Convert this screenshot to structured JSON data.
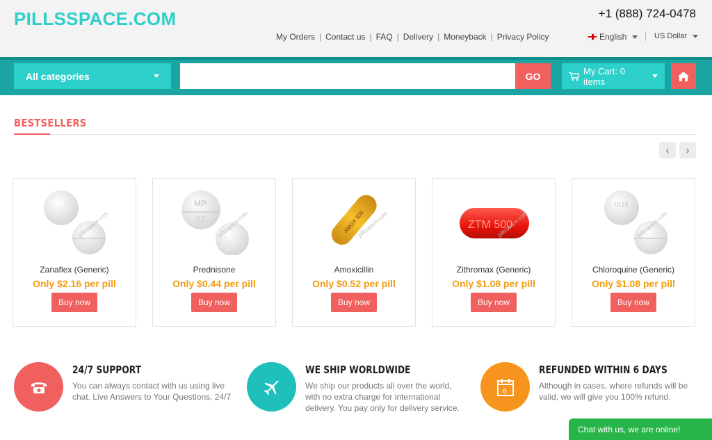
{
  "header": {
    "logo": "PILLSSPACE.COM",
    "phone": "+1 (888) 724-0478",
    "nav": [
      "My Orders",
      "Contact us",
      "FAQ",
      "Delivery",
      "Moneyback",
      "Privacy Policy"
    ],
    "language": "English",
    "currency": "US Dollar"
  },
  "toolbar": {
    "category": "All categories",
    "search_value": "",
    "go_label": "GO",
    "cart_label": "My Cart: 0 items"
  },
  "bestsellers": {
    "title": "BESTSELLERS",
    "watermark": "pillsspace.com",
    "products": [
      {
        "name": "Zanaflex (Generic)",
        "price": "Only $2.16 per pill",
        "button": "Buy now"
      },
      {
        "name": "Prednisone",
        "price": "Only $0.44 per pill",
        "button": "Buy now"
      },
      {
        "name": "Amoxicillin",
        "price": "Only $0.52 per pill",
        "button": "Buy now"
      },
      {
        "name": "Zithromax (Generic)",
        "price": "Only $1.08 per pill",
        "button": "Buy now"
      },
      {
        "name": "Chloroquine (Generic)",
        "price": "Only $1.08 per pill",
        "button": "Buy now"
      }
    ],
    "pill_text": {
      "prednisone": "MP",
      "prednisone2": "52",
      "amoxicillin": "AMOX 500",
      "zithromax": "ZTM 500",
      "chloroquine": "0115"
    }
  },
  "features": [
    {
      "title": "24/7 SUPPORT",
      "text": "You can always contact with us using live chat. Live Answers to Your Questions, 24/7",
      "color": "#f0605e",
      "icon": "phone-icon"
    },
    {
      "title": "WE SHIP WORLDWIDE",
      "text": "We ship our products all over the world, with no extra charge for international delivery. You pay only for delivery service.",
      "color": "#1fc0bb",
      "icon": "airplane-icon"
    },
    {
      "title": "REFUNDED WITHIN 6 DAYS",
      "text": "Although in cases, where refunds will be valid, we will give you 100% refund.",
      "color": "#f7941d",
      "icon": "calendar-icon",
      "calendar_number": "6"
    }
  ],
  "chat": {
    "label": "Chat with us, we are online!"
  },
  "colors": {
    "teal": "#2ccfc9",
    "teal_dark": "#1aa5a2",
    "red": "#f0605e",
    "orange": "#f39c12"
  }
}
